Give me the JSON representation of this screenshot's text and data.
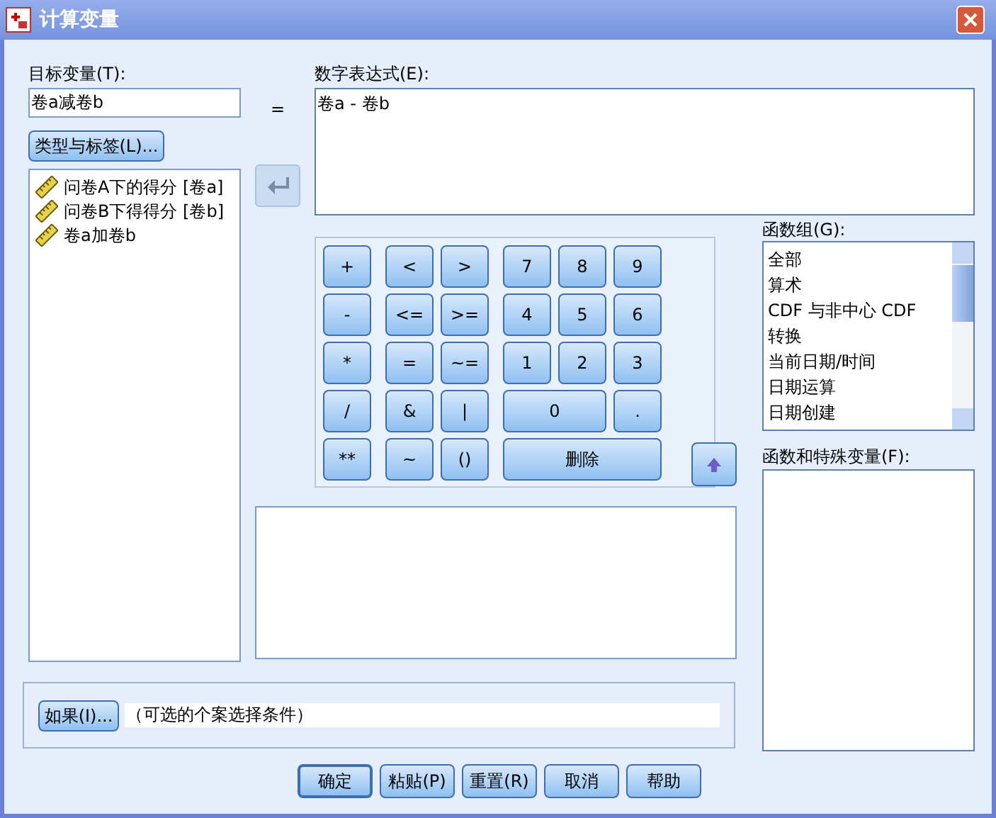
{
  "window": {
    "title": "计算变量"
  },
  "target": {
    "label": "目标变量(T):",
    "value": "卷a减卷b"
  },
  "equals": "=",
  "type_label_button": "类型与标签(L)...",
  "variables": [
    {
      "label": "问卷A下的得分 [卷a]"
    },
    {
      "label": "问卷B下得得分 [卷b]"
    },
    {
      "label": "卷a加卷b"
    }
  ],
  "expression": {
    "label": "数字表达式(E):",
    "value": "卷a - 卷b"
  },
  "keypad": [
    "+",
    "<",
    ">",
    "7",
    "8",
    "9",
    "-",
    "<=",
    ">=",
    "4",
    "5",
    "6",
    "*",
    "=",
    "~=",
    "1",
    "2",
    "3",
    "/",
    "&",
    "|",
    "0",
    ".",
    "**",
    "~",
    "()",
    "删除"
  ],
  "function_group": {
    "label": "函数组(G):",
    "items": [
      {
        "label": "全部"
      },
      {
        "label": "算术"
      },
      {
        "label": "CDF 与非中心 CDF"
      },
      {
        "label": "转换"
      },
      {
        "label": "当前日期/时间"
      },
      {
        "label": "日期运算"
      },
      {
        "label": "日期创建"
      }
    ]
  },
  "functions": {
    "label": "函数和特殊变量(F):"
  },
  "if_button": "如果(I)...",
  "if_condition": "（可选的个案选择条件）",
  "buttons": [
    {
      "label": "确定",
      "default": true
    },
    {
      "label": "粘贴(P)",
      "default": false
    },
    {
      "label": "重置(R)",
      "default": false
    },
    {
      "label": "取消",
      "default": false
    },
    {
      "label": "帮助",
      "default": false
    }
  ]
}
